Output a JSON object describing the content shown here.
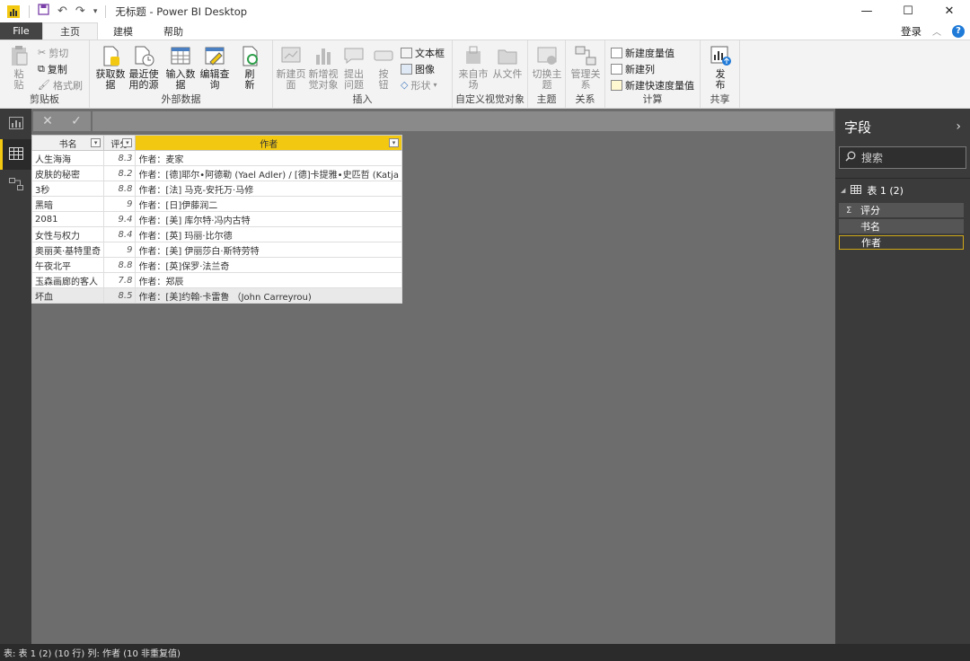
{
  "window": {
    "title": "无标题 - Power BI Desktop",
    "controls": [
      "—",
      "☐",
      "✕"
    ]
  },
  "menu": {
    "tabs": [
      "File",
      "主页",
      "建模",
      "帮助"
    ],
    "active_tab": "主页",
    "signin": "登录",
    "help_glyph": "?"
  },
  "ribbon": {
    "clipboard": {
      "paste": "粘贴",
      "cut": "剪切",
      "copy": "复制",
      "format_painter": "格式刷",
      "label": "剪贴板"
    },
    "external_data": {
      "get_data": "获取数据",
      "recent_sources": "最近使用的源",
      "enter_data": "输入数据",
      "edit_queries": "编辑查询",
      "refresh": "刷新",
      "label": "外部数据"
    },
    "insert": {
      "new_page": "新建页面",
      "new_visual": "新增视觉对象",
      "ask_question": "提出问题",
      "buttons": "按钮",
      "textbox": "文本框",
      "image": "图像",
      "shapes": "形状",
      "label": "插入"
    },
    "custom_visuals": {
      "from_marketplace": "来自市场",
      "from_file": "从文件",
      "label": "自定义视觉对象"
    },
    "themes": {
      "switch_theme": "切换主题",
      "label": "主题"
    },
    "relationships": {
      "manage": "管理关系",
      "label": "关系"
    },
    "calculations": {
      "new_measure": "新建度量值",
      "new_column": "新建列",
      "new_quick_measure": "新建快速度量值",
      "label": "计算"
    },
    "share": {
      "publish": "发布",
      "label": "共享"
    }
  },
  "formula_bar": {
    "cancel": "✕",
    "commit": "✓",
    "value": ""
  },
  "table": {
    "columns": [
      "书名",
      "评分",
      "作者"
    ],
    "selected_column": "作者",
    "rows": [
      [
        "人生海海",
        "8.3",
        "作者：麦家"
      ],
      [
        "皮肤的秘密",
        "8.2",
        "作者：[德]耶尔•阿德勒 (Yael Adler) / [德]卡提雅•史匹哲 (Katja"
      ],
      [
        "3秒",
        "8.8",
        "作者：[法] 马克-安托万·马修"
      ],
      [
        "黑暗",
        "9",
        "作者：[日]伊藤润二"
      ],
      [
        "2081",
        "9.4",
        "作者：[美] 库尔特·冯内古特"
      ],
      [
        "女性与权力",
        "8.4",
        "作者：[英] 玛丽·比尔德"
      ],
      [
        "奥丽芙·基特里奇",
        "9",
        "作者：[美] 伊丽莎白·斯特劳特"
      ],
      [
        "午夜北平",
        "8.8",
        "作者：[英]保罗·法兰奇"
      ],
      [
        "玉森画廊的客人",
        "7.8",
        "作者：郑辰"
      ],
      [
        "坏血",
        "8.5",
        "作者：[美]约翰·卡雷鲁 （John Carreyrou)"
      ]
    ]
  },
  "fields_pane": {
    "title": "字段",
    "search_placeholder": "搜索",
    "table_name": "表 1 (2)",
    "fields": [
      "评分",
      "书名",
      "作者"
    ],
    "sum_glyph": "Σ",
    "selected_field": "作者"
  },
  "status_bar": {
    "text": "表: 表 1 (2) (10 行) 列: 作者 (10 非重复值)"
  },
  "colors": {
    "accent": "#f2c811",
    "canvas": "#6d6d6d",
    "pane": "#3b3b3b"
  }
}
